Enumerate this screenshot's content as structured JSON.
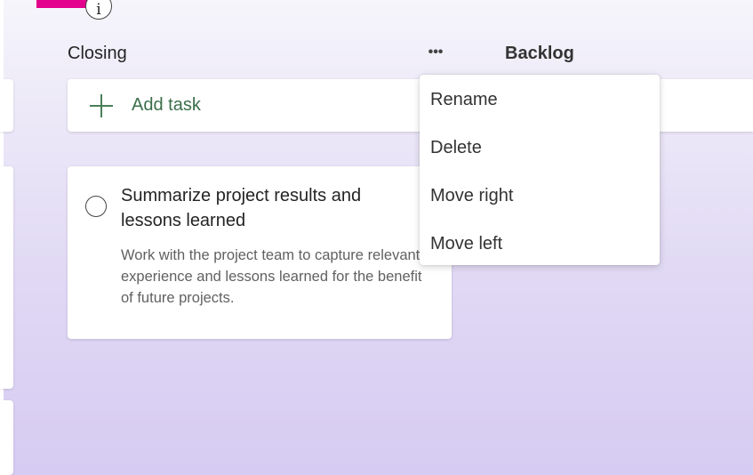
{
  "header": {
    "info_icon_glyph": "i"
  },
  "buckets": [
    {
      "title": "Closing",
      "more_glyph": "•••",
      "add_task_label": "Add task",
      "tasks": [
        {
          "title": "Summarize project results and lessons learned",
          "description": "Work with the project team to capture relevant experience and lessons learned for the benefit of future projects."
        }
      ]
    },
    {
      "title": "Backlog"
    }
  ],
  "context_menu": {
    "items": [
      {
        "label": "Rename"
      },
      {
        "label": "Delete"
      },
      {
        "label": "Move right"
      },
      {
        "label": "Move left"
      }
    ]
  },
  "colors": {
    "accent_pink": "#e3008c",
    "add_task_green": "#3b6e4a"
  },
  "icons": [
    "info-icon",
    "plus-icon",
    "more-options-icon",
    "checkbox-circle-icon"
  ]
}
